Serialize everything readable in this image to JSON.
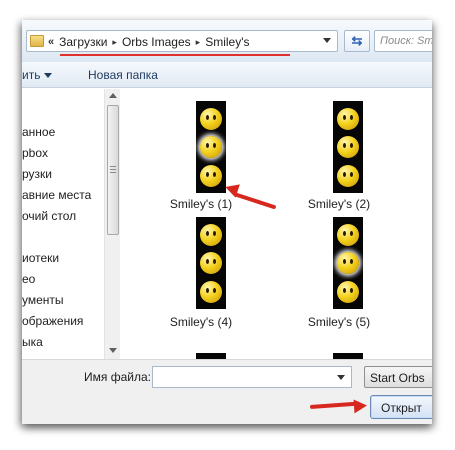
{
  "address": {
    "overflow_glyph": "«",
    "crumbs": [
      "Загрузки",
      "Orbs Images",
      "Smiley's"
    ],
    "separator": "▸",
    "refresh_icon": "⇆",
    "search_placeholder": "Поиск: Sm"
  },
  "toolbar": {
    "organize_label": "ить",
    "new_folder_label": "Новая папка"
  },
  "nav": {
    "items": [
      "анное",
      "pbox",
      "рузки",
      "авние места",
      "очий стол",
      "иотеки",
      "ео",
      "ументы",
      "ображения",
      "ыка"
    ]
  },
  "files": [
    {
      "name": "Smiley's (1)"
    },
    {
      "name": "Smiley's (2)"
    },
    {
      "name": "Smiley's (4)"
    },
    {
      "name": "Smiley's (5)"
    },
    {
      "name": ""
    },
    {
      "name": ""
    }
  ],
  "bottom": {
    "filename_label": "Имя файла:",
    "filename_value": "",
    "filter_label": "Start Orbs",
    "open_label": "Открыт"
  },
  "colors": {
    "annotation_red": "#d6281f",
    "address_underline": "#e0302c"
  }
}
